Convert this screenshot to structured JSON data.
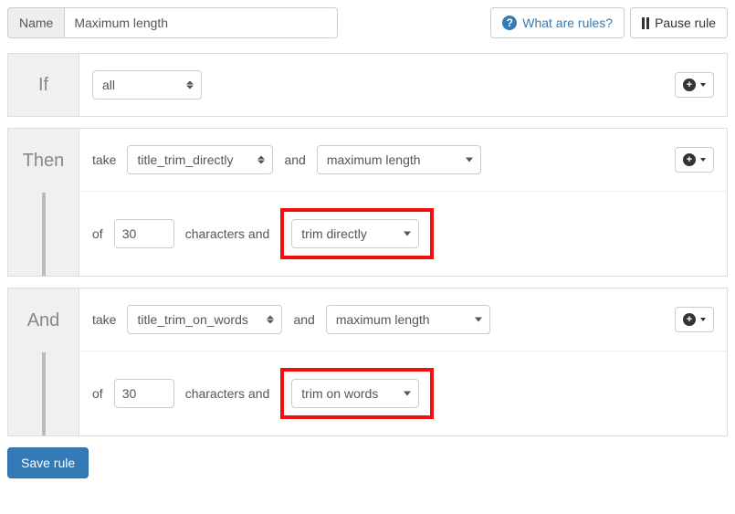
{
  "header": {
    "name_label": "Name",
    "name_value": "Maximum length",
    "help_link": "What are rules?",
    "pause_label": "Pause rule"
  },
  "if_block": {
    "label": "If",
    "condition": "all"
  },
  "then_block": {
    "label": "Then",
    "row1": {
      "take": "take",
      "field": "title_trim_directly",
      "and": "and",
      "action": "maximum length"
    },
    "row2": {
      "of": "of",
      "count": "30",
      "chars_and": "characters and",
      "trim_mode": "trim directly"
    }
  },
  "and_block": {
    "label": "And",
    "row1": {
      "take": "take",
      "field": "title_trim_on_words",
      "and": "and",
      "action": "maximum length"
    },
    "row2": {
      "of": "of",
      "count": "30",
      "chars_and": "characters and",
      "trim_mode": "trim on words"
    }
  },
  "save_label": "Save rule"
}
